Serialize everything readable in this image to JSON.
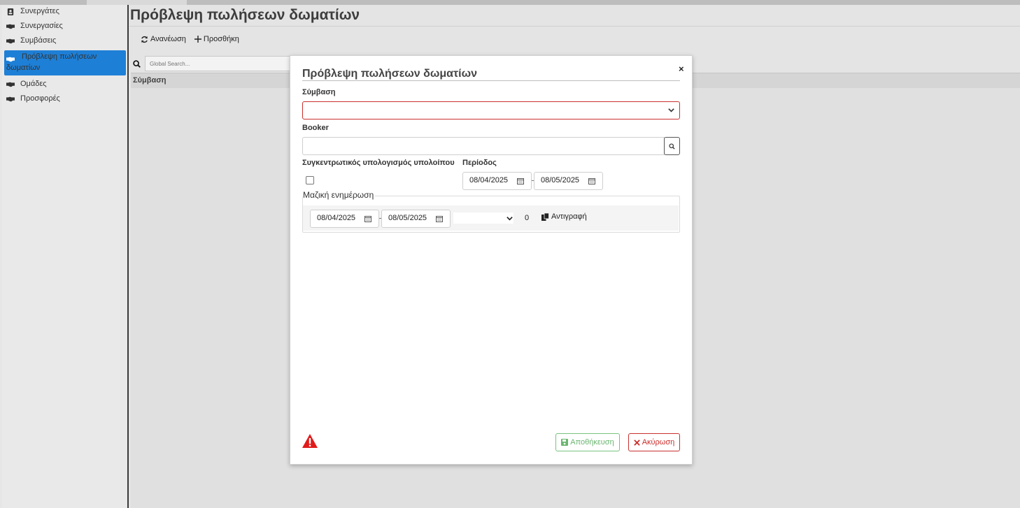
{
  "sidebar": {
    "items": [
      {
        "label": "Συνεργάτες",
        "icon": "contact-card-icon"
      },
      {
        "label": "Συνεργασίες",
        "icon": "handshake-icon"
      },
      {
        "label": "Συμβάσεις",
        "icon": "handshake-icon"
      },
      {
        "label": "Πρόβλεψη πωλήσεων δωματίων",
        "icon": "handshake-icon",
        "active": true
      },
      {
        "label": "Ομάδες",
        "icon": "handshake-icon"
      },
      {
        "label": "Προσφορές",
        "icon": "handshake-icon"
      }
    ]
  },
  "main": {
    "title": "Πρόβλεψη πωλήσεων δωματίων",
    "toolbar": {
      "refresh_label": "Ανανέωση",
      "add_label": "Προσθήκη"
    },
    "search": {
      "placeholder": "Global Search..."
    },
    "grid": {
      "columns": [
        "Σύμβαση"
      ]
    }
  },
  "modal": {
    "title": "Πρόβλεψη πωλήσεων δωματίων",
    "close_label": "×",
    "contract_label": "Σύμβαση",
    "contract_value": "",
    "booker_label": "Booker",
    "booker_value": "",
    "aggregate_label": "Συγκεντρωτικός υπολογισμός υπολοίπου",
    "aggregate_checked": false,
    "period_label": "Περίοδος",
    "period_from": "08/04/2025",
    "period_to": "08/05/2025",
    "bulk_legend": "Μαζική ενημέρωση",
    "bulk_from": "08/04/2025",
    "bulk_to": "08/05/2025",
    "bulk_select_value": "",
    "bulk_count": "0",
    "copy_label": "Αντιγραφή",
    "save_label": "Αποθήκευση",
    "cancel_label": "Ακύρωση"
  },
  "colors": {
    "accent": "#1e7fd6",
    "danger": "#c9302c",
    "success": "#6ab56f",
    "warning_icon": "#e11b1b"
  }
}
